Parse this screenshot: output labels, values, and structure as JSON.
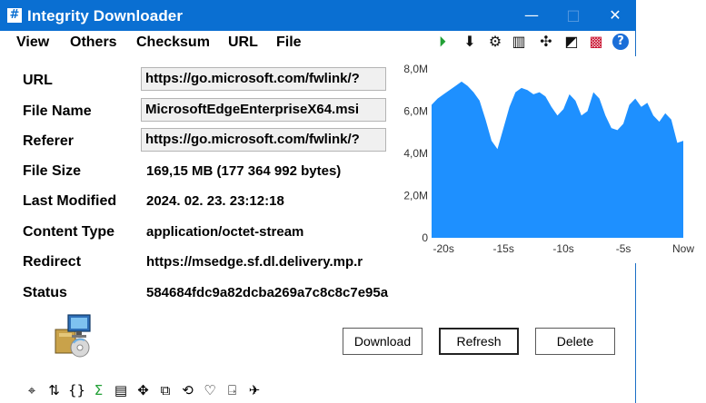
{
  "window": {
    "title": "Integrity Downloader",
    "app_icon_glyph": "#",
    "min_glyph": "—",
    "max_glyph": "□",
    "close_glyph": "✕"
  },
  "menu": {
    "items": [
      "View",
      "Others",
      "Checksum",
      "URL",
      "File"
    ]
  },
  "toolbar": {
    "icons": [
      {
        "name": "play-icon",
        "glyph": "⏵",
        "color": "#22a036"
      },
      {
        "name": "download-arrow-icon",
        "glyph": "⬇",
        "color": "#111111"
      },
      {
        "name": "gear-icon",
        "glyph": "⚙",
        "color": "#111111"
      },
      {
        "name": "bar-chart-icon",
        "glyph": "▥",
        "color": "#111111"
      },
      {
        "name": "network-icon",
        "glyph": "✣",
        "color": "#111111"
      },
      {
        "name": "contrast-icon",
        "glyph": "◩",
        "color": "#111111"
      },
      {
        "name": "uk-flag-icon",
        "glyph": "▩",
        "color": "#c8102e"
      },
      {
        "name": "help-icon",
        "glyph": "?",
        "color": "#1a6ed8"
      }
    ]
  },
  "fields": {
    "url_label": "URL",
    "url_value": "https://go.microsoft.com/fwlink/?",
    "file_name_label": "File Name",
    "file_name_value": "MicrosoftEdgeEnterpriseX64.msi",
    "referer_label": "Referer",
    "referer_value": "https://go.microsoft.com/fwlink/?",
    "file_size_label": "File Size",
    "file_size_value": "169,15 MB (177 364 992 bytes)",
    "last_modified_label": "Last Modified",
    "last_modified_value": "2024. 02. 23. 23:12:18",
    "content_type_label": "Content Type",
    "content_type_value": "application/octet-stream",
    "redirect_label": "Redirect",
    "redirect_value": "https://msedge.sf.dl.delivery.mp.r",
    "status_label": "Status",
    "status_value": "584684fdc9a82dcba269a7c8c8c7e95a"
  },
  "buttons": {
    "download": "Download",
    "refresh": "Refresh",
    "delete": "Delete"
  },
  "bottom_toolbar": {
    "icons": [
      {
        "name": "pin-icon",
        "glyph": "⌖"
      },
      {
        "name": "sort-icon",
        "glyph": "⇅"
      },
      {
        "name": "braces-icon",
        "glyph": "{}"
      },
      {
        "name": "sigma-icon",
        "glyph": "Σ",
        "color": "#22a036"
      },
      {
        "name": "document-icon",
        "glyph": "▤"
      },
      {
        "name": "move-icon",
        "glyph": "✥"
      },
      {
        "name": "copy-icon",
        "glyph": "⧉"
      },
      {
        "name": "history-icon",
        "glyph": "⟲"
      },
      {
        "name": "heart-icon",
        "glyph": "♡"
      },
      {
        "name": "import-icon",
        "glyph": "⍈"
      },
      {
        "name": "runner-icon",
        "glyph": "✈"
      }
    ]
  },
  "chart_data": {
    "type": "area",
    "color": "#1e90ff",
    "ylim": [
      0,
      8.0
    ],
    "xlim": [
      -21,
      0
    ],
    "yticks": [
      "0",
      "2,0M",
      "4,0M",
      "6,0M",
      "8,0M"
    ],
    "xticks": [
      "-20s",
      "-15s",
      "-10s",
      "-5s",
      "Now"
    ],
    "x": [
      -21,
      -20.5,
      -20,
      -19.5,
      -19,
      -18.5,
      -18,
      -17.5,
      -17,
      -16.5,
      -16,
      -15.5,
      -15,
      -14.5,
      -14,
      -13.5,
      -13,
      -12.5,
      -12,
      -11.5,
      -11,
      -10.5,
      -10,
      -9.5,
      -9,
      -8.5,
      -8,
      -7.5,
      -7,
      -6.5,
      -6,
      -5.5,
      -5,
      -4.5,
      -4,
      -3.5,
      -3,
      -2.5,
      -2,
      -1.5,
      -1,
      -0.5,
      0
    ],
    "y": [
      6.3,
      6.6,
      6.8,
      7.0,
      7.2,
      7.4,
      7.2,
      6.9,
      6.5,
      5.6,
      4.6,
      4.2,
      5.2,
      6.2,
      6.9,
      7.1,
      7.0,
      6.8,
      6.9,
      6.7,
      6.2,
      5.8,
      6.1,
      6.8,
      6.5,
      5.8,
      6.0,
      6.9,
      6.6,
      5.8,
      5.2,
      5.1,
      5.4,
      6.3,
      6.6,
      6.2,
      6.4,
      5.8,
      5.5,
      5.9,
      5.6,
      4.5,
      4.6
    ]
  }
}
